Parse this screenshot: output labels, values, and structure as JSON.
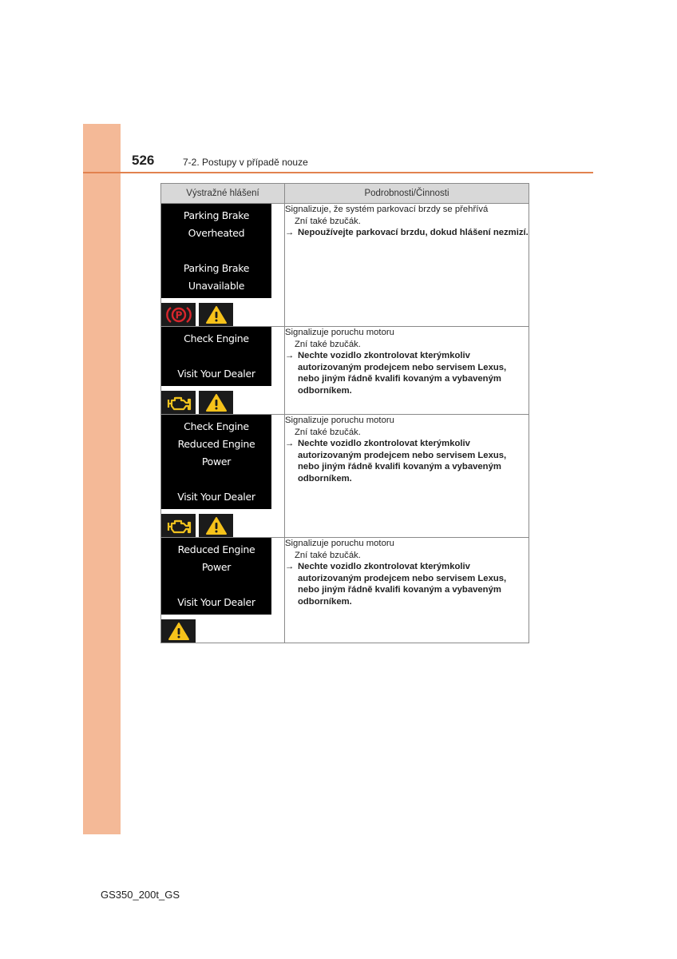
{
  "header": {
    "page_number": "526",
    "section_title": "7-2. Postupy v případě nouze"
  },
  "table": {
    "columns": [
      "Výstražné hlášení",
      "Podrobnosti/Činnosti"
    ],
    "rows": [
      {
        "screen_lines": [
          "Parking Brake",
          "Overheated",
          "",
          "Parking Brake",
          "Unavailable"
        ],
        "icons": [
          "parking-brake-icon",
          "warning-triangle-icon"
        ],
        "description": "Signalizuje, že systém parkovací brzdy se přehřívá",
        "buzzer": "Zní také bzučák.",
        "arrow": "→",
        "action": "Nepoužívejte parkovací brzdu, dokud hlášení nezmizí."
      },
      {
        "screen_lines": [
          "Check Engine",
          "",
          "Visit Your Dealer"
        ],
        "icons": [
          "check-engine-icon",
          "warning-triangle-icon"
        ],
        "description": "Signalizuje poruchu motoru",
        "buzzer": "Zní také bzučák.",
        "arrow": "→",
        "action": "Nechte vozidlo zkontrolovat kterýmkoliv autorizovaným prodejcem nebo servisem Lexus, nebo jiným řádně kvalifi kovaným a vybaveným odborníkem."
      },
      {
        "screen_lines": [
          "Check Engine",
          "Reduced Engine",
          "Power",
          "",
          "Visit Your Dealer"
        ],
        "icons": [
          "check-engine-icon",
          "warning-triangle-icon"
        ],
        "description": "Signalizuje poruchu motoru",
        "buzzer": "Zní také bzučák.",
        "arrow": "→",
        "action": "Nechte vozidlo zkontrolovat kterýmkoliv autorizovaným prodejcem nebo servisem Lexus, nebo jiným řádně kvalifi kovaným a vybaveným odborníkem."
      },
      {
        "screen_lines": [
          "Reduced Engine",
          "Power",
          "",
          "Visit Your Dealer"
        ],
        "icons": [
          "warning-triangle-icon"
        ],
        "description": "Signalizuje poruchu motoru",
        "buzzer": "Zní také bzučák.",
        "arrow": "→",
        "action": "Nechte vozidlo zkontrolovat kterýmkoliv autorizovaným prodejcem nebo servisem Lexus, nebo jiným řádně kvalifi kovaným a vybaveným odborníkem."
      }
    ]
  },
  "colors": {
    "side_tab": "#f4b997",
    "rule": "#e2824f",
    "header_bg": "#d8d8d8",
    "parking_brake_red": "#d8262c",
    "warning_yellow": "#f6c21a",
    "engine_yellow": "#f0c21e"
  },
  "footer": {
    "model_code": "GS350_200t_GS"
  }
}
